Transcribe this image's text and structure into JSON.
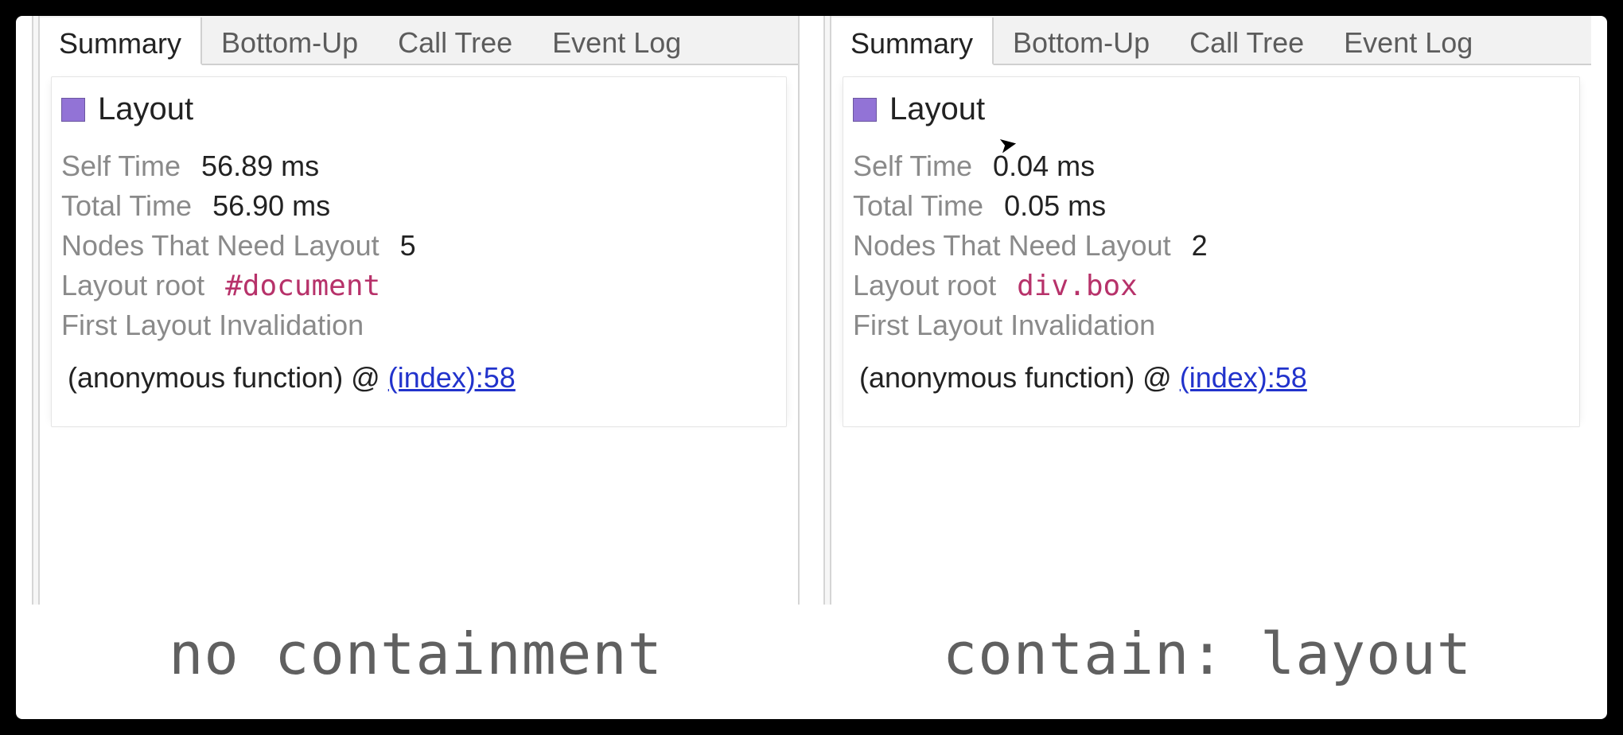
{
  "tabs": [
    "Summary",
    "Bottom-Up",
    "Call Tree",
    "Event Log"
  ],
  "event_name": "Layout",
  "swatch_color": "#9273d6",
  "labels": {
    "self_time": "Self Time",
    "total_time": "Total Time",
    "nodes_need_layout": "Nodes That Need Layout",
    "layout_root": "Layout root",
    "first_invalidation": "First Layout Invalidation"
  },
  "left": {
    "self_time": "56.89 ms",
    "total_time": "56.90 ms",
    "nodes_need_layout": "5",
    "layout_root": "#document",
    "invalidation_prefix": "(anonymous function) @ ",
    "invalidation_source": "(index):58",
    "caption": "no containment"
  },
  "right": {
    "self_time": "0.04 ms",
    "total_time": "0.05 ms",
    "nodes_need_layout": "2",
    "layout_root": "div.box",
    "invalidation_prefix": "(anonymous function) @ ",
    "invalidation_source": "(index):58",
    "caption": "contain: layout"
  }
}
